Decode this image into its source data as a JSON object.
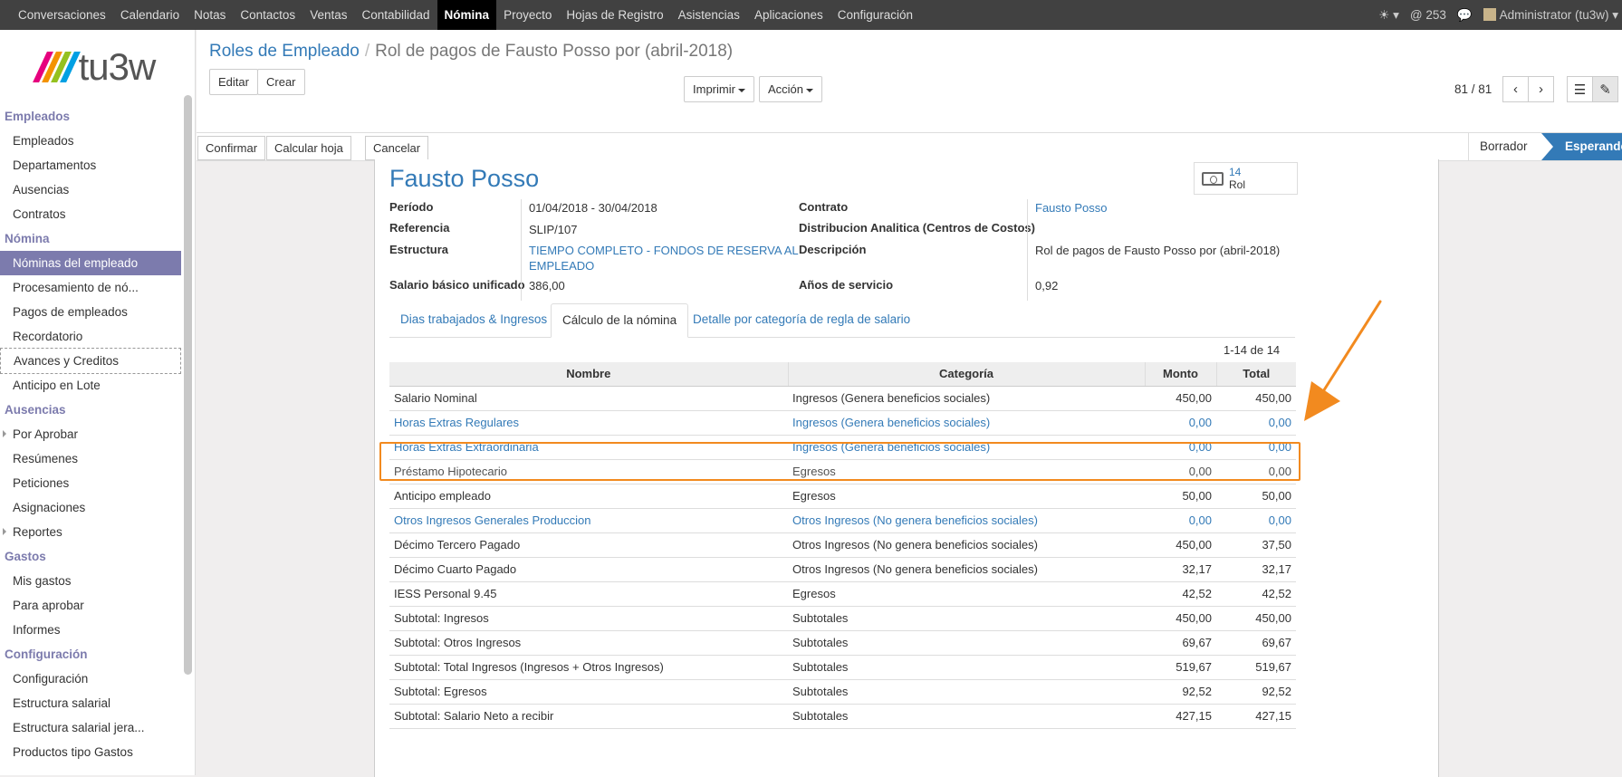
{
  "topbar": {
    "nav": [
      "Conversaciones",
      "Calendario",
      "Notas",
      "Contactos",
      "Ventas",
      "Contabilidad",
      "Nómina",
      "Proyecto",
      "Hojas de Registro",
      "Asistencias",
      "Aplicaciones",
      "Configuración"
    ],
    "active_nav": "Nómina",
    "bug_icon": "bug-icon",
    "mentions": "@ 253",
    "chat_icon": "chat-icon",
    "user": "Administrator (tu3w)"
  },
  "logo": {
    "text": "tu3w",
    "colors": [
      "#e6007e",
      "#f39200",
      "#95c11f",
      "#00a0e3"
    ]
  },
  "sidebar": {
    "sections": [
      {
        "title": "Empleados",
        "items": [
          "Empleados",
          "Departamentos",
          "Ausencias",
          "Contratos"
        ]
      },
      {
        "title": "Nómina",
        "items": [
          "Nóminas del empleado",
          "Procesamiento de nó...",
          "Pagos de empleados",
          "Recordatorio",
          "Avances y Creditos",
          "Anticipo en Lote"
        ]
      },
      {
        "title": "Ausencias",
        "items": [
          "Por Aprobar",
          "Resúmenes",
          "Peticiones",
          "Asignaciones",
          "Reportes"
        ]
      },
      {
        "title": "Gastos",
        "items": [
          "Mis gastos",
          "Para aprobar",
          "Informes"
        ]
      },
      {
        "title": "Configuración",
        "items": [
          "Configuración",
          "Estructura salarial",
          "Estructura salarial jera...",
          "Productos tipo Gastos"
        ]
      }
    ],
    "active_item": "Nóminas del empleado"
  },
  "breadcrumb": {
    "parent": "Roles de Empleado",
    "current": "Rol de pagos de Fausto Posso por (abril-2018)"
  },
  "buttons": {
    "edit": "Editar",
    "create": "Crear",
    "print": "Imprimir",
    "action": "Acción"
  },
  "pager": {
    "value": "81 / 81"
  },
  "statusbar": {
    "confirm": "Confirmar",
    "compute": "Calcular hoja",
    "cancel": "Cancelar",
    "stage_draft": "Borrador",
    "stage_waiting": "Esperando"
  },
  "sheet": {
    "employee": "Fausto Posso",
    "stat_count": "14",
    "stat_label": "Rol",
    "fields": {
      "periodo_label": "Período",
      "periodo_value": "01/04/2018 - 30/04/2018",
      "referencia_label": "Referencia",
      "referencia_value": "SLIP/107",
      "estructura_label": "Estructura",
      "estructura_value_1": "TIEMPO COMPLETO - FONDOS DE RESERVA AL",
      "estructura_value_2": "EMPLEADO",
      "salario_label": "Salario básico unificado",
      "salario_value": "386,00",
      "contrato_label": "Contrato",
      "contrato_value": "Fausto Posso",
      "distribucion_label": "Distribucion Analitica (Centros de Costos)",
      "distribucion_value": "",
      "descripcion_label": "Descripción",
      "descripcion_value": "Rol de pagos de Fausto Posso por (abril-2018)",
      "anios_label": "Años de servicio",
      "anios_value": "0,92"
    },
    "tabs": [
      "Dias trabajados & Ingresos",
      "Cálculo de la nómina",
      "Detalle por categoría de regla de salario"
    ],
    "active_tab": "Cálculo de la nómina",
    "record_count": "1-14 de 14",
    "columns": [
      "Nombre",
      "Categoría",
      "Monto",
      "Total"
    ],
    "rows": [
      {
        "name": "Salario Nominal",
        "category": "Ingresos (Genera beneficios sociales)",
        "amount": "450,00",
        "total": "450,00",
        "style": ""
      },
      {
        "name": "Horas Extras Regulares",
        "category": "Ingresos (Genera beneficios sociales)",
        "amount": "0,00",
        "total": "0,00",
        "style": "link"
      },
      {
        "name": "Horas Extras Extraordinaria",
        "category": "Ingresos (Genera beneficios sociales)",
        "amount": "0,00",
        "total": "0,00",
        "style": "link"
      },
      {
        "name": "Préstamo Hipotecario",
        "category": "Egresos",
        "amount": "0,00",
        "total": "0,00",
        "style": "strike"
      },
      {
        "name": "Anticipo empleado",
        "category": "Egresos",
        "amount": "50,00",
        "total": "50,00",
        "style": ""
      },
      {
        "name": "Otros Ingresos Generales Produccion",
        "category": "Otros Ingresos (No genera beneficios sociales)",
        "amount": "0,00",
        "total": "0,00",
        "style": "link"
      },
      {
        "name": "Décimo Tercero Pagado",
        "category": "Otros Ingresos (No genera beneficios sociales)",
        "amount": "450,00",
        "total": "37,50",
        "style": ""
      },
      {
        "name": "Décimo Cuarto Pagado",
        "category": "Otros Ingresos (No genera beneficios sociales)",
        "amount": "32,17",
        "total": "32,17",
        "style": ""
      },
      {
        "name": "IESS Personal 9.45",
        "category": "Egresos",
        "amount": "42,52",
        "total": "42,52",
        "style": ""
      },
      {
        "name": "Subtotal: Ingresos",
        "category": "Subtotales",
        "amount": "450,00",
        "total": "450,00",
        "style": ""
      },
      {
        "name": "Subtotal: Otros Ingresos",
        "category": "Subtotales",
        "amount": "69,67",
        "total": "69,67",
        "style": ""
      },
      {
        "name": "Subtotal: Total Ingresos (Ingresos + Otros Ingresos)",
        "category": "Subtotales",
        "amount": "519,67",
        "total": "519,67",
        "style": ""
      },
      {
        "name": "Subtotal: Egresos",
        "category": "Subtotales",
        "amount": "92,52",
        "total": "92,52",
        "style": ""
      },
      {
        "name": "Subtotal: Salario Neto a recibir",
        "category": "Subtotales",
        "amount": "427,15",
        "total": "427,15",
        "style": ""
      }
    ]
  },
  "annotation": {
    "color": "#f28a1f",
    "highlight_row": "Anticipo empleado"
  }
}
